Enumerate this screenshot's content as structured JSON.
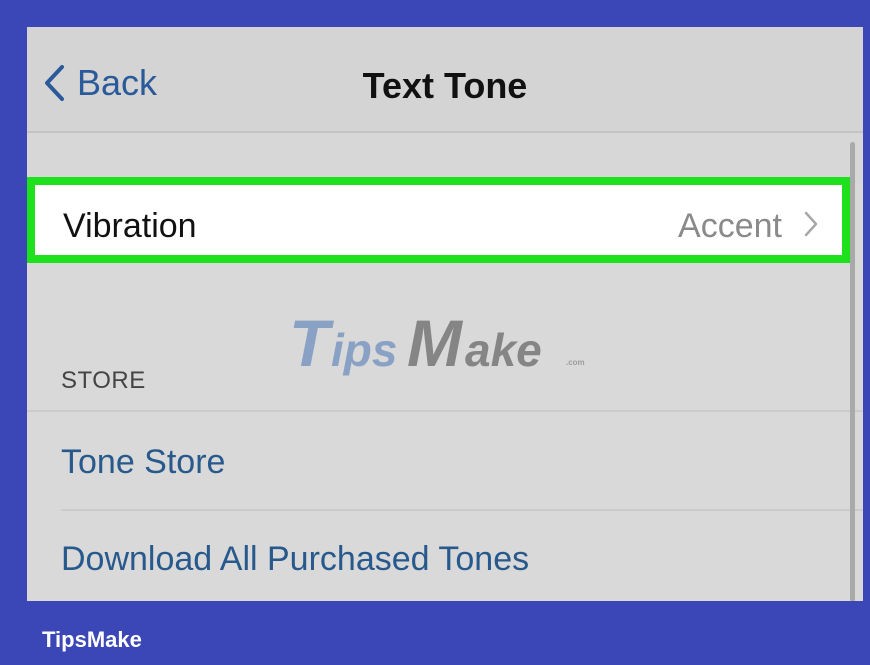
{
  "navbar": {
    "back_label": "Back",
    "title": "Text Tone"
  },
  "vibration": {
    "label": "Vibration",
    "value": "Accent"
  },
  "store": {
    "header": "STORE",
    "items": [
      {
        "label": "Tone Store"
      },
      {
        "label": "Download All Purchased Tones"
      }
    ]
  },
  "watermark": {
    "part1_big": "T",
    "part1_rest": "ips",
    "part2_big": "M",
    "part2_rest": "ake",
    "suffix": ".com"
  },
  "footer": {
    "brand": "TipsMake"
  },
  "colors": {
    "frame": "#3c47b7",
    "highlight": "#1ee11e",
    "link": "#28598d",
    "screen_bg": "#d9d9d9"
  },
  "icons": {
    "back": "chevron-left-icon",
    "disclosure": "chevron-right-icon"
  }
}
